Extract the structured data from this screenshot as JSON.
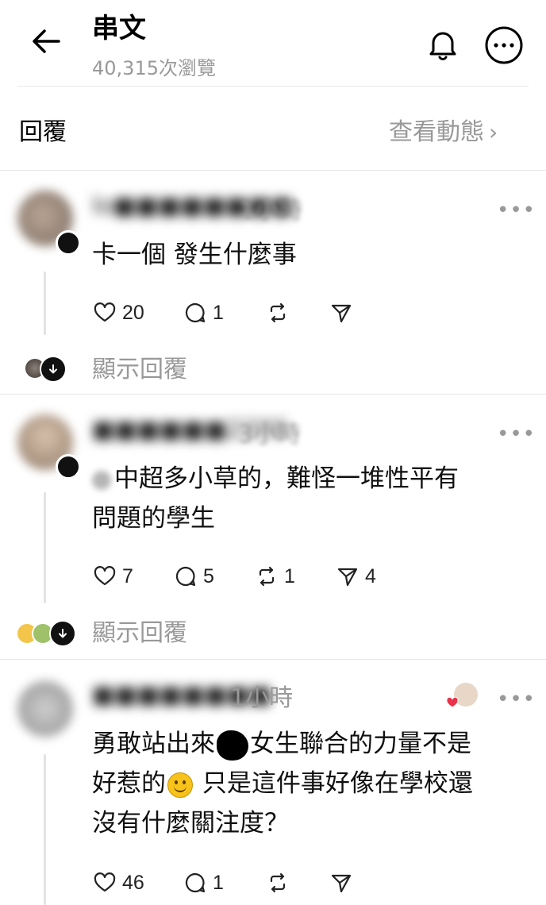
{
  "header": {
    "title": "串文",
    "view_count": "40,315次瀏覽"
  },
  "replies_bar": {
    "label": "回覆",
    "activity_link": "查看動態"
  },
  "comments": [
    {
      "username_blurred": "lo■■■■■■■■",
      "time": "1小時",
      "body_lines": [
        "卡一個 發生什麼事"
      ],
      "likes": "20",
      "replies": "1",
      "reposts": "",
      "shares": "",
      "show_replies": "顯示回覆"
    },
    {
      "username_blurred": "■■■■■■2200",
      "time": "3小時",
      "body_lines": [
        "中超多小草的，難怪一堆性平有",
        "問題的學生"
      ],
      "likes": "7",
      "replies": "5",
      "reposts": "1",
      "shares": "4",
      "show_replies": "顯示回覆"
    },
    {
      "username_blurred": "■■■■■■■■",
      "time": "1小時",
      "body_lines": [
        "勇敢站出來",
        "女生聯合的力量不是",
        "好惹的",
        "只是這件事好像在學校還",
        "沒有什麼關注度？"
      ],
      "likes": "46",
      "replies": "1",
      "reposts": "",
      "shares": ""
    }
  ],
  "icons": {
    "back": "arrow-left-icon",
    "bell": "bell-icon",
    "more": "more-horizontal-icon",
    "like": "heart-icon",
    "reply": "comment-icon",
    "repost": "repost-icon",
    "share": "send-icon"
  },
  "colors": {
    "text": "#101010",
    "secondary": "#999999",
    "divider": "#e6e6e6",
    "accent": "#111111"
  }
}
